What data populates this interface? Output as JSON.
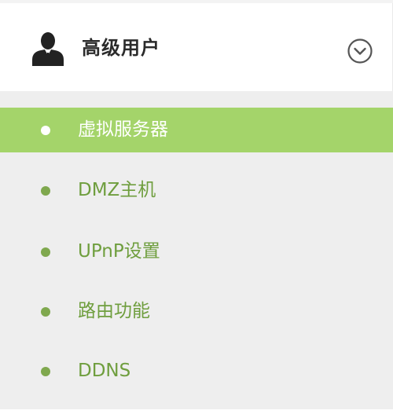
{
  "header": {
    "title": "高级用户",
    "user_icon": "user-icon",
    "toggle_icon": "chevron-down-circle-icon"
  },
  "menu": {
    "items": [
      {
        "label": "虚拟服务器",
        "active": true
      },
      {
        "label": "DMZ主机",
        "active": false
      },
      {
        "label": "UPnP设置",
        "active": false
      },
      {
        "label": "路由功能",
        "active": false
      },
      {
        "label": "DDNS",
        "active": false
      }
    ]
  },
  "colors": {
    "active_bg": "#a4d46a",
    "item_text": "#6f9e3e",
    "menu_bg": "#eeeeee",
    "title_text": "#2b2b2b"
  }
}
